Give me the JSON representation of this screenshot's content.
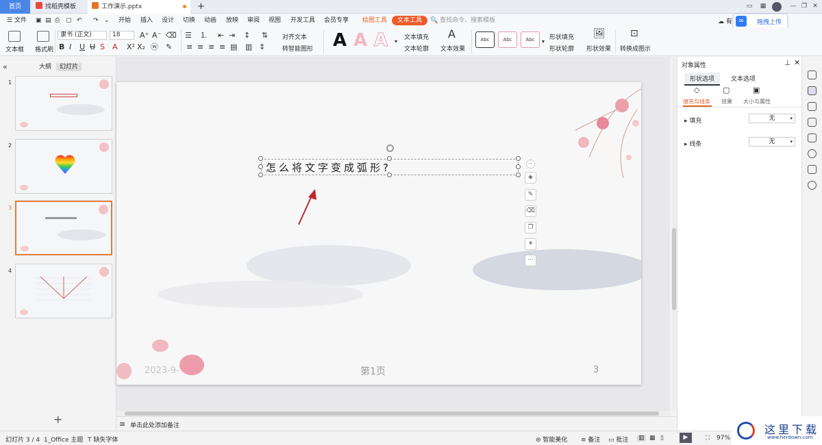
{
  "tabs": {
    "home": "首页",
    "template": "找稻壳模板",
    "file": "工作演示.pptx"
  },
  "menu": {
    "file": "文件",
    "items": [
      "开始",
      "插入",
      "设计",
      "切换",
      "动画",
      "放映",
      "审阅",
      "视图",
      "开发工具",
      "会员专享"
    ],
    "drawing_tools": "绘图工具",
    "text_tools": "文本工具",
    "search": "查找命令、搜索模板",
    "share": "有",
    "upload": "拖拽上传"
  },
  "toolbar": {
    "textbox": "文本框",
    "format_painter": "格式刷",
    "font": "隶书 (正文)",
    "font_size": "18",
    "align_text": "对齐文本",
    "smart_shape": "转智能图形",
    "text_fill": "文本填充",
    "text_outline": "文本轮廓",
    "text_effect": "文本效果",
    "shape_fill": "形状填充",
    "shape_outline": "形状轮廓",
    "shape_effect": "形状效果",
    "convert_demo": "转换成图示",
    "style_sample": "Abc",
    "wordart_sample": "A"
  },
  "left_panel": {
    "tab_outline": "大纲",
    "tab_slides": "幻灯片",
    "slides": [
      "1",
      "2",
      "3",
      "4"
    ],
    "add": "+"
  },
  "slide": {
    "text": "怎么将文字变成弧形?",
    "date": "2023-9-",
    "page_label": "第1页",
    "number": "3"
  },
  "notes": "单击此处添加备注",
  "right_panel": {
    "title": "对象属性",
    "tab_shape": "形状选项",
    "tab_text": "文本选项",
    "sub_fill": "填充与线条",
    "sub_effect": "效果",
    "sub_size": "大小与属性",
    "fill_label": "填充",
    "fill_value": "无",
    "line_label": "线条",
    "line_value": "无"
  },
  "status": {
    "slide_info": "幻灯片 3 / 4",
    "theme": "1_Office 主题",
    "missing_font": "缺失字体",
    "beautify": "智能美化",
    "notes": "备注",
    "comments": "批注",
    "zoom": "97%"
  },
  "watermark": {
    "text": "这里下载",
    "url": "www.herdown.com"
  },
  "colors": {
    "accent": "#e0642c",
    "home_tab": "#4a86e8",
    "arrow": "#c0282d"
  }
}
